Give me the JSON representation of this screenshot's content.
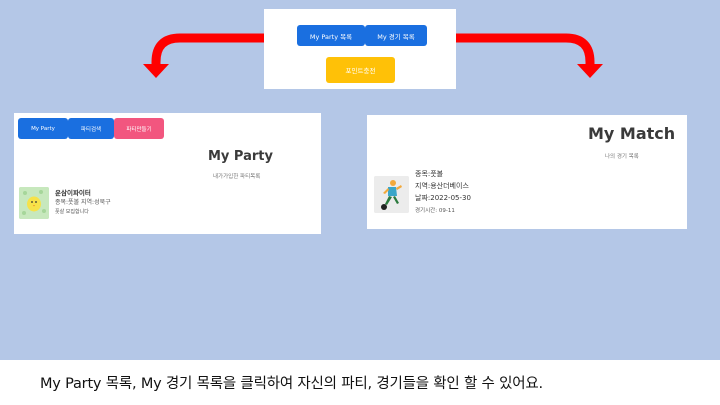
{
  "top_panel": {
    "my_party_list_button": "My Party 목록",
    "my_match_list_button": "My 경기 목록",
    "point_charge_button": "포인트충전"
  },
  "party_panel": {
    "tabs": [
      {
        "label": "My Party",
        "color": "#1a6fe0"
      },
      {
        "label": "파티검색",
        "color": "#1a6fe0"
      },
      {
        "label": "파티만들기",
        "color": "#f2567f"
      }
    ],
    "title": "My Party",
    "subtitle": "내가가입한 파티목록",
    "party_card": {
      "name": "운삼이파이터",
      "info": "종목:풋볼 지역:성북구",
      "status": "풋살 모집합니다"
    }
  },
  "match_panel": {
    "title": "My Match",
    "subtitle": "나의 경기 목록",
    "match_card": {
      "sport": "종목:풋볼",
      "region": "지역:용산더베이스",
      "date": "날짜:2022-05-30",
      "time": "경기시간: 09-11"
    }
  },
  "caption": "My Party 목록, My 경기 목록을 클릭하여 자신의 파티, 경기들을 확인 할 수 있어요.",
  "colors": {
    "background": "#b4c7e7",
    "arrow": "#ff0000",
    "primary_button": "#1a6fe0",
    "accent_button": "#f2567f",
    "charge_button": "#ffc107"
  }
}
